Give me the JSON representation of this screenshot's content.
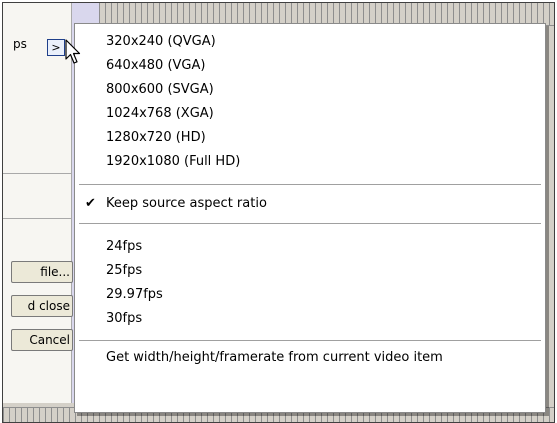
{
  "background": {
    "label_partial": "ps",
    "expand_button_label": ">",
    "buttons": {
      "file": "file...",
      "close": "d close",
      "cancel": "Cancel"
    }
  },
  "menu": {
    "resolutions": [
      "320x240 (QVGA)",
      "640x480 (VGA)",
      "800x600 (SVGA)",
      "1024x768 (XGA)",
      "1280x720 (HD)",
      "1920x1080 (Full HD)"
    ],
    "aspect": {
      "label": "Keep source aspect ratio",
      "checked": true,
      "check_mark": "✔"
    },
    "framerates": [
      "24fps",
      "25fps",
      "29.97fps",
      "30fps"
    ],
    "from_item": "Get width/height/framerate from current video item"
  },
  "colors": {
    "menu_bg": "#ffffff",
    "menu_border": "#8a8a8a",
    "dialog_bg": "#d4d0c8",
    "button_border": "#1f3f8a"
  }
}
